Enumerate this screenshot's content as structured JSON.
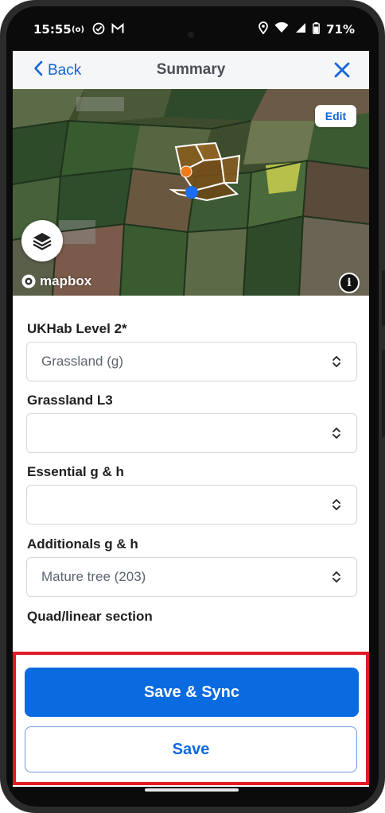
{
  "status_bar": {
    "time": "15:55",
    "battery": "71%",
    "icons_left": [
      "hotspot-icon",
      "check-circle-icon",
      "gmail-icon"
    ],
    "icons_right": [
      "location-icon",
      "wifi-icon",
      "signal-icon",
      "battery-icon"
    ]
  },
  "nav": {
    "back_label": "Back",
    "title": "Summary",
    "close_icon": "close-icon"
  },
  "map": {
    "edit_label": "Edit",
    "attribution": "mapbox",
    "info_label": "i",
    "layers_icon": "layers-icon",
    "colors": {
      "polygon_fill": "#8a5a1c",
      "polygon_stroke": "#ffffff",
      "marker_orange": "#f07a1a",
      "marker_blue": "#1a6cf0"
    }
  },
  "form": {
    "fields": [
      {
        "label": "UKHab Level 2*",
        "value": "Grassland (g)"
      },
      {
        "label": "Grassland L3",
        "value": ""
      },
      {
        "label": "Essential g & h",
        "value": ""
      },
      {
        "label": "Additionals g & h",
        "value": "Mature tree (203)"
      }
    ],
    "section_heading": "Quad/linear section"
  },
  "footer": {
    "save_sync_label": "Save & Sync",
    "save_label": "Save",
    "highlight_color": "#e01b24",
    "primary_color": "#0a6adf"
  }
}
